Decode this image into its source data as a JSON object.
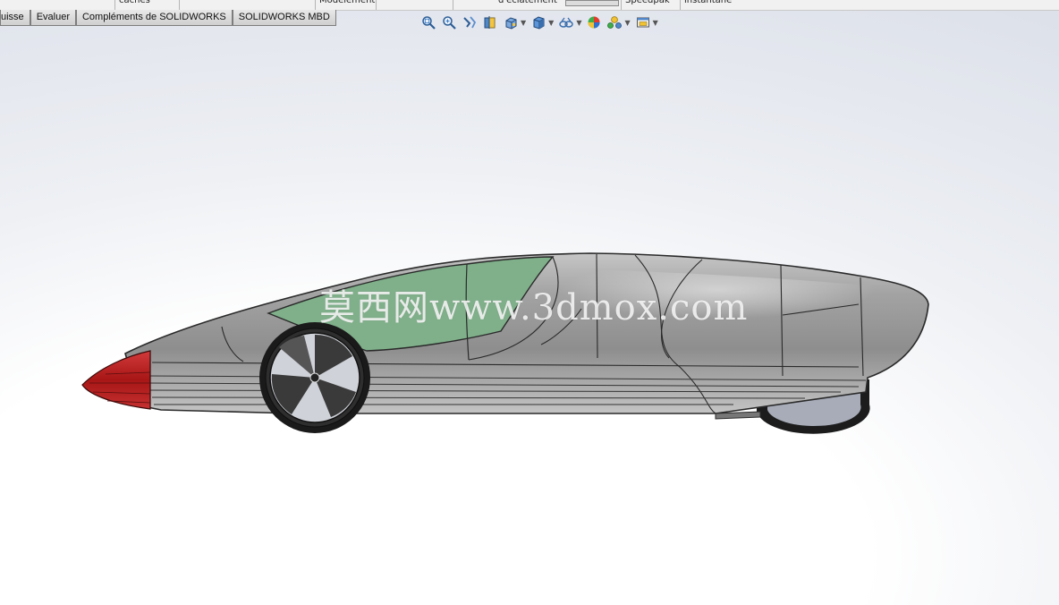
{
  "ribbon_strip": {
    "segments": [
      "cachés",
      "Modèlement",
      "d'éclatement",
      "Speedpak",
      "instantané"
    ]
  },
  "command_tabs": [
    "uisse",
    "Evaluer",
    "Compléments de SOLIDWORKS",
    "SOLIDWORKS MBD"
  ],
  "heads_up_toolbar": {
    "icons": [
      "zoom-to-fit-icon",
      "zoom-to-area-icon",
      "previous-view-icon",
      "section-view-icon",
      "view-orientation-icon",
      "display-style-icon",
      "hide-show-items-icon",
      "edit-appearance-icon",
      "apply-scene-icon",
      "view-settings-icon"
    ]
  },
  "viewport": {
    "watermark": "莫西网www.3dmox.com",
    "colors": {
      "body": "#9b9b9b",
      "canopy": "#7fb08a",
      "nose": "#b51d1d",
      "tire": "#1c1c1c"
    }
  }
}
